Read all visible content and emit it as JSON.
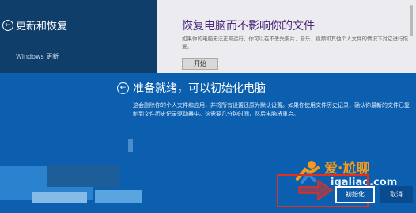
{
  "sidebar": {
    "title": "更新和恢复",
    "item": "Windows 更新"
  },
  "right_panel": {
    "title": "恢复电脑而不影响你的文件",
    "description": "如果你的电脑无法正常运行，你可以在不丢失照片、音乐、视频和其他个人文件的情况下对它进行恢复。",
    "start_label": "开始"
  },
  "dialog": {
    "title": "准备就绪，可以初始化电脑",
    "description": "这会删除你的个人文件和应用，并将所有设置还原为默认设置。如果你使用文件历史记录，确认你最新的文件已复制到文件历史记录驱动器中。这需要几分钟时间，然后电脑将重启。",
    "reset_label": "初始化",
    "cancel_label": "取消"
  },
  "watermark": {
    "brand": "爱·尬聊",
    "domain": "igaliao.com"
  },
  "colors": {
    "sidebar_bg": "#0f3e6a",
    "dialog_bg": "#0b5fae",
    "panel_title": "#4a2a7a",
    "highlight_box": "#e23020",
    "watermark_orange": "#f39a1e"
  },
  "icons": [
    "back-arrow-icon",
    "watermark-logo-icon",
    "pointer-arrow-icon"
  ]
}
